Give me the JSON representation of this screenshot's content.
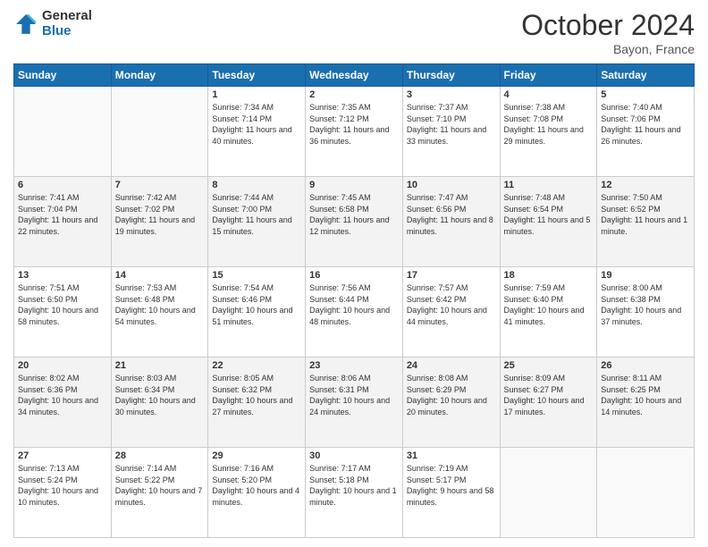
{
  "logo": {
    "general": "General",
    "blue": "Blue"
  },
  "header": {
    "month": "October 2024",
    "location": "Bayon, France"
  },
  "weekdays": [
    "Sunday",
    "Monday",
    "Tuesday",
    "Wednesday",
    "Thursday",
    "Friday",
    "Saturday"
  ],
  "weeks": [
    [
      {
        "day": "",
        "sunrise": "",
        "sunset": "",
        "daylight": ""
      },
      {
        "day": "",
        "sunrise": "",
        "sunset": "",
        "daylight": ""
      },
      {
        "day": "1",
        "sunrise": "Sunrise: 7:34 AM",
        "sunset": "Sunset: 7:14 PM",
        "daylight": "Daylight: 11 hours and 40 minutes."
      },
      {
        "day": "2",
        "sunrise": "Sunrise: 7:35 AM",
        "sunset": "Sunset: 7:12 PM",
        "daylight": "Daylight: 11 hours and 36 minutes."
      },
      {
        "day": "3",
        "sunrise": "Sunrise: 7:37 AM",
        "sunset": "Sunset: 7:10 PM",
        "daylight": "Daylight: 11 hours and 33 minutes."
      },
      {
        "day": "4",
        "sunrise": "Sunrise: 7:38 AM",
        "sunset": "Sunset: 7:08 PM",
        "daylight": "Daylight: 11 hours and 29 minutes."
      },
      {
        "day": "5",
        "sunrise": "Sunrise: 7:40 AM",
        "sunset": "Sunset: 7:06 PM",
        "daylight": "Daylight: 11 hours and 26 minutes."
      }
    ],
    [
      {
        "day": "6",
        "sunrise": "Sunrise: 7:41 AM",
        "sunset": "Sunset: 7:04 PM",
        "daylight": "Daylight: 11 hours and 22 minutes."
      },
      {
        "day": "7",
        "sunrise": "Sunrise: 7:42 AM",
        "sunset": "Sunset: 7:02 PM",
        "daylight": "Daylight: 11 hours and 19 minutes."
      },
      {
        "day": "8",
        "sunrise": "Sunrise: 7:44 AM",
        "sunset": "Sunset: 7:00 PM",
        "daylight": "Daylight: 11 hours and 15 minutes."
      },
      {
        "day": "9",
        "sunrise": "Sunrise: 7:45 AM",
        "sunset": "Sunset: 6:58 PM",
        "daylight": "Daylight: 11 hours and 12 minutes."
      },
      {
        "day": "10",
        "sunrise": "Sunrise: 7:47 AM",
        "sunset": "Sunset: 6:56 PM",
        "daylight": "Daylight: 11 hours and 8 minutes."
      },
      {
        "day": "11",
        "sunrise": "Sunrise: 7:48 AM",
        "sunset": "Sunset: 6:54 PM",
        "daylight": "Daylight: 11 hours and 5 minutes."
      },
      {
        "day": "12",
        "sunrise": "Sunrise: 7:50 AM",
        "sunset": "Sunset: 6:52 PM",
        "daylight": "Daylight: 11 hours and 1 minute."
      }
    ],
    [
      {
        "day": "13",
        "sunrise": "Sunrise: 7:51 AM",
        "sunset": "Sunset: 6:50 PM",
        "daylight": "Daylight: 10 hours and 58 minutes."
      },
      {
        "day": "14",
        "sunrise": "Sunrise: 7:53 AM",
        "sunset": "Sunset: 6:48 PM",
        "daylight": "Daylight: 10 hours and 54 minutes."
      },
      {
        "day": "15",
        "sunrise": "Sunrise: 7:54 AM",
        "sunset": "Sunset: 6:46 PM",
        "daylight": "Daylight: 10 hours and 51 minutes."
      },
      {
        "day": "16",
        "sunrise": "Sunrise: 7:56 AM",
        "sunset": "Sunset: 6:44 PM",
        "daylight": "Daylight: 10 hours and 48 minutes."
      },
      {
        "day": "17",
        "sunrise": "Sunrise: 7:57 AM",
        "sunset": "Sunset: 6:42 PM",
        "daylight": "Daylight: 10 hours and 44 minutes."
      },
      {
        "day": "18",
        "sunrise": "Sunrise: 7:59 AM",
        "sunset": "Sunset: 6:40 PM",
        "daylight": "Daylight: 10 hours and 41 minutes."
      },
      {
        "day": "19",
        "sunrise": "Sunrise: 8:00 AM",
        "sunset": "Sunset: 6:38 PM",
        "daylight": "Daylight: 10 hours and 37 minutes."
      }
    ],
    [
      {
        "day": "20",
        "sunrise": "Sunrise: 8:02 AM",
        "sunset": "Sunset: 6:36 PM",
        "daylight": "Daylight: 10 hours and 34 minutes."
      },
      {
        "day": "21",
        "sunrise": "Sunrise: 8:03 AM",
        "sunset": "Sunset: 6:34 PM",
        "daylight": "Daylight: 10 hours and 30 minutes."
      },
      {
        "day": "22",
        "sunrise": "Sunrise: 8:05 AM",
        "sunset": "Sunset: 6:32 PM",
        "daylight": "Daylight: 10 hours and 27 minutes."
      },
      {
        "day": "23",
        "sunrise": "Sunrise: 8:06 AM",
        "sunset": "Sunset: 6:31 PM",
        "daylight": "Daylight: 10 hours and 24 minutes."
      },
      {
        "day": "24",
        "sunrise": "Sunrise: 8:08 AM",
        "sunset": "Sunset: 6:29 PM",
        "daylight": "Daylight: 10 hours and 20 minutes."
      },
      {
        "day": "25",
        "sunrise": "Sunrise: 8:09 AM",
        "sunset": "Sunset: 6:27 PM",
        "daylight": "Daylight: 10 hours and 17 minutes."
      },
      {
        "day": "26",
        "sunrise": "Sunrise: 8:11 AM",
        "sunset": "Sunset: 6:25 PM",
        "daylight": "Daylight: 10 hours and 14 minutes."
      }
    ],
    [
      {
        "day": "27",
        "sunrise": "Sunrise: 7:13 AM",
        "sunset": "Sunset: 5:24 PM",
        "daylight": "Daylight: 10 hours and 10 minutes."
      },
      {
        "day": "28",
        "sunrise": "Sunrise: 7:14 AM",
        "sunset": "Sunset: 5:22 PM",
        "daylight": "Daylight: 10 hours and 7 minutes."
      },
      {
        "day": "29",
        "sunrise": "Sunrise: 7:16 AM",
        "sunset": "Sunset: 5:20 PM",
        "daylight": "Daylight: 10 hours and 4 minutes."
      },
      {
        "day": "30",
        "sunrise": "Sunrise: 7:17 AM",
        "sunset": "Sunset: 5:18 PM",
        "daylight": "Daylight: 10 hours and 1 minute."
      },
      {
        "day": "31",
        "sunrise": "Sunrise: 7:19 AM",
        "sunset": "Sunset: 5:17 PM",
        "daylight": "Daylight: 9 hours and 58 minutes."
      },
      {
        "day": "",
        "sunrise": "",
        "sunset": "",
        "daylight": ""
      },
      {
        "day": "",
        "sunrise": "",
        "sunset": "",
        "daylight": ""
      }
    ]
  ]
}
